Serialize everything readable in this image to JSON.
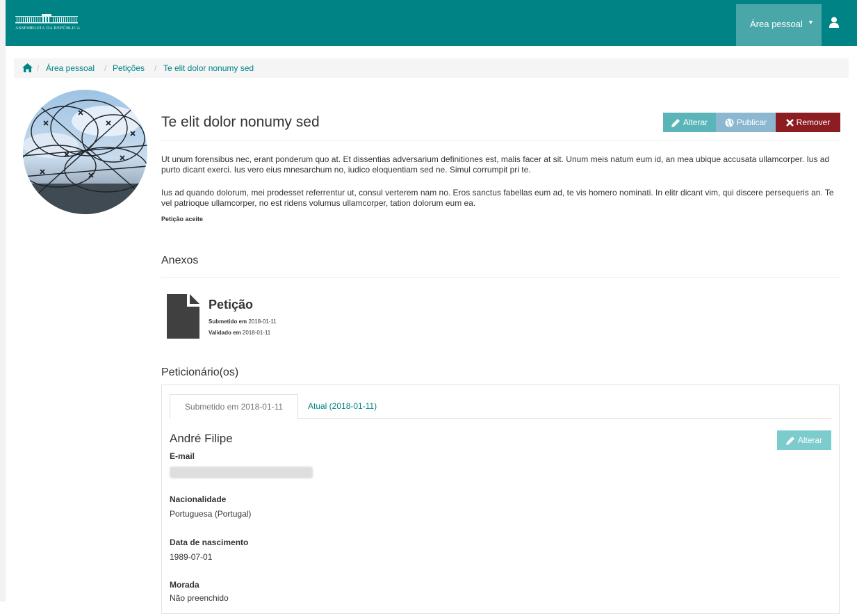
{
  "header": {
    "logo_text": "ASSEMBLEIA DA REPÚBLICA",
    "user_menu_label": "Área pessoal",
    "brand_color": "#008385"
  },
  "breadcrumb": {
    "items": [
      "Área pessoal",
      "Petições",
      "Te elit dolor nonumy sed"
    ]
  },
  "petition": {
    "title": "Te elit dolor nonumy sed",
    "actions": {
      "edit": "Alterar",
      "publish": "Publicar",
      "remove": "Remover"
    },
    "paragraphs": [
      "Ut unum forensibus nec, erant ponderum quo at. Et dissentias adversarium definitiones est, malis facer at sit. Unum meis natum eum id, an mea ubique accusata ullamcorper. Ius ad purto dicant exerci. Ius vero eius mnesarchum no, iudico eloquentiam sed ne. Simul corrumpit pri te.",
      "Ius ad quando dolorum, mei prodesset referrentur ut, consul verterem nam no. Eros sanctus fabellas eum ad, te vis homero nominati. In elitr dicant vim, qui discere persequeris an. Te vel patrioque ullamcorper, no est ridens volumus ullamcorper, tation dolorum eum ea."
    ],
    "status": "Petição aceite"
  },
  "attachments": {
    "heading": "Anexos",
    "file": {
      "name": "Petição",
      "submitted_label": "Submetido em",
      "submitted_date": "2018-01-11",
      "validated_label": "Validado em",
      "validated_date": "2018-01-11"
    }
  },
  "petitioners": {
    "heading": "Peticionário(os)",
    "tabs": [
      "Submetido em 2018-01-11",
      "Atual (2018-01-11)"
    ],
    "person": {
      "name": "André Filipe",
      "edit": "Alterar",
      "fields": [
        {
          "label": "E-mail",
          "value": ""
        },
        {
          "label": "Nacionalidade",
          "value": "Portuguesa (Portugal)"
        },
        {
          "label": "Data de nascimento",
          "value": "1989-07-01"
        },
        {
          "label": "Morada",
          "value": "Não preenchido"
        }
      ]
    }
  }
}
